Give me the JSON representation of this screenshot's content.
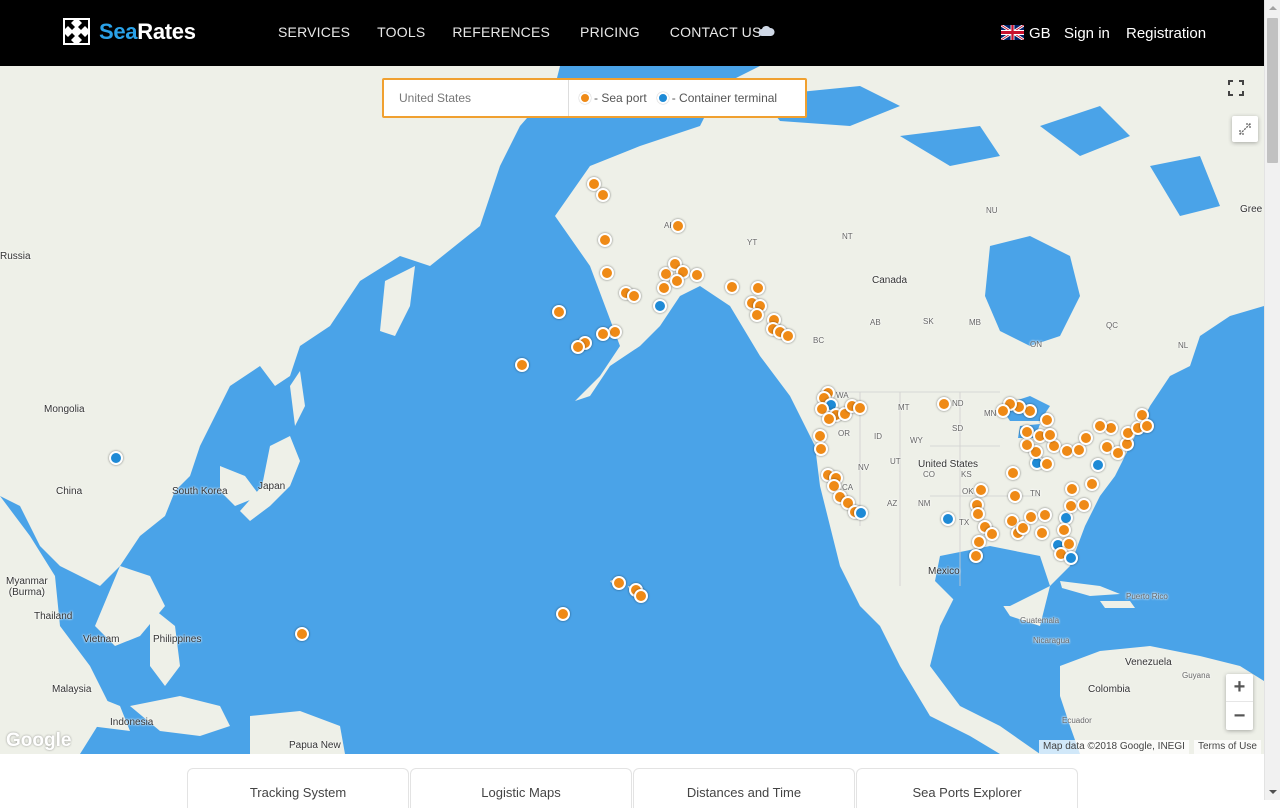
{
  "brand": {
    "sea": "Sea",
    "rates": "Rates"
  },
  "nav": {
    "items": [
      "SERVICES",
      "TOOLS",
      "REFERENCES",
      "PRICING",
      "CONTACT US"
    ],
    "weather_icon": "cloud-icon"
  },
  "account": {
    "region": "GB",
    "signin": "Sign in",
    "register": "Registration"
  },
  "search": {
    "value": "United States"
  },
  "legend": {
    "sea_port": "- Sea port",
    "terminal": "- Container terminal"
  },
  "map": {
    "labels": {
      "russia": "Russia",
      "mongolia": "Mongolia",
      "china": "China",
      "south_korea": "South Korea",
      "japan": "Japan",
      "myanmar": "Myanmar\n(Burma)",
      "thailand": "Thailand",
      "vietnam": "Vietnam",
      "philippines": "Philippines",
      "malaysia": "Malaysia",
      "indonesia": "Indonesia",
      "papua": "Papua New",
      "canada": "Canada",
      "united_states": "United States",
      "mexico": "Mexico",
      "greenland": "Gree",
      "venezuela": "Venezuela",
      "colombia": "Colombia",
      "guyana": "Guyana",
      "ecuador": "Ecuador",
      "puerto_rico": "Puerto Rico",
      "guatemala": "Guatemala",
      "nicaragua": "Nicaragua",
      "ak": "AK",
      "yt": "YT",
      "nt": "NT",
      "nu": "NU",
      "bc": "BC",
      "ab": "AB",
      "sk": "SK",
      "mb": "MB",
      "on": "ON",
      "qc": "QC",
      "nl": "NL",
      "wa": "WA",
      "or": "OR",
      "mt": "MT",
      "nd": "ND",
      "sd": "SD",
      "id": "ID",
      "wy": "WY",
      "nv": "NV",
      "ut": "UT",
      "co": "CO",
      "ca": "CA",
      "az": "AZ",
      "nm": "NM",
      "tx": "TX",
      "ks": "KS",
      "ok": "OK",
      "mn": "MN",
      "tn": "TN"
    },
    "google": "Google",
    "attribution": "Map data ©2018 Google, INEGI",
    "terms": "Terms of Use",
    "zoom_in": "+",
    "zoom_out": "−"
  },
  "tabs": [
    "Tracking System",
    "Logistic Maps",
    "Distances and Time",
    "Sea Ports Explorer"
  ],
  "colors": {
    "sea_port": "#ef8a16",
    "terminal": "#1e8ad6",
    "water": "#4aa3e8",
    "land": "#eef0e8"
  }
}
